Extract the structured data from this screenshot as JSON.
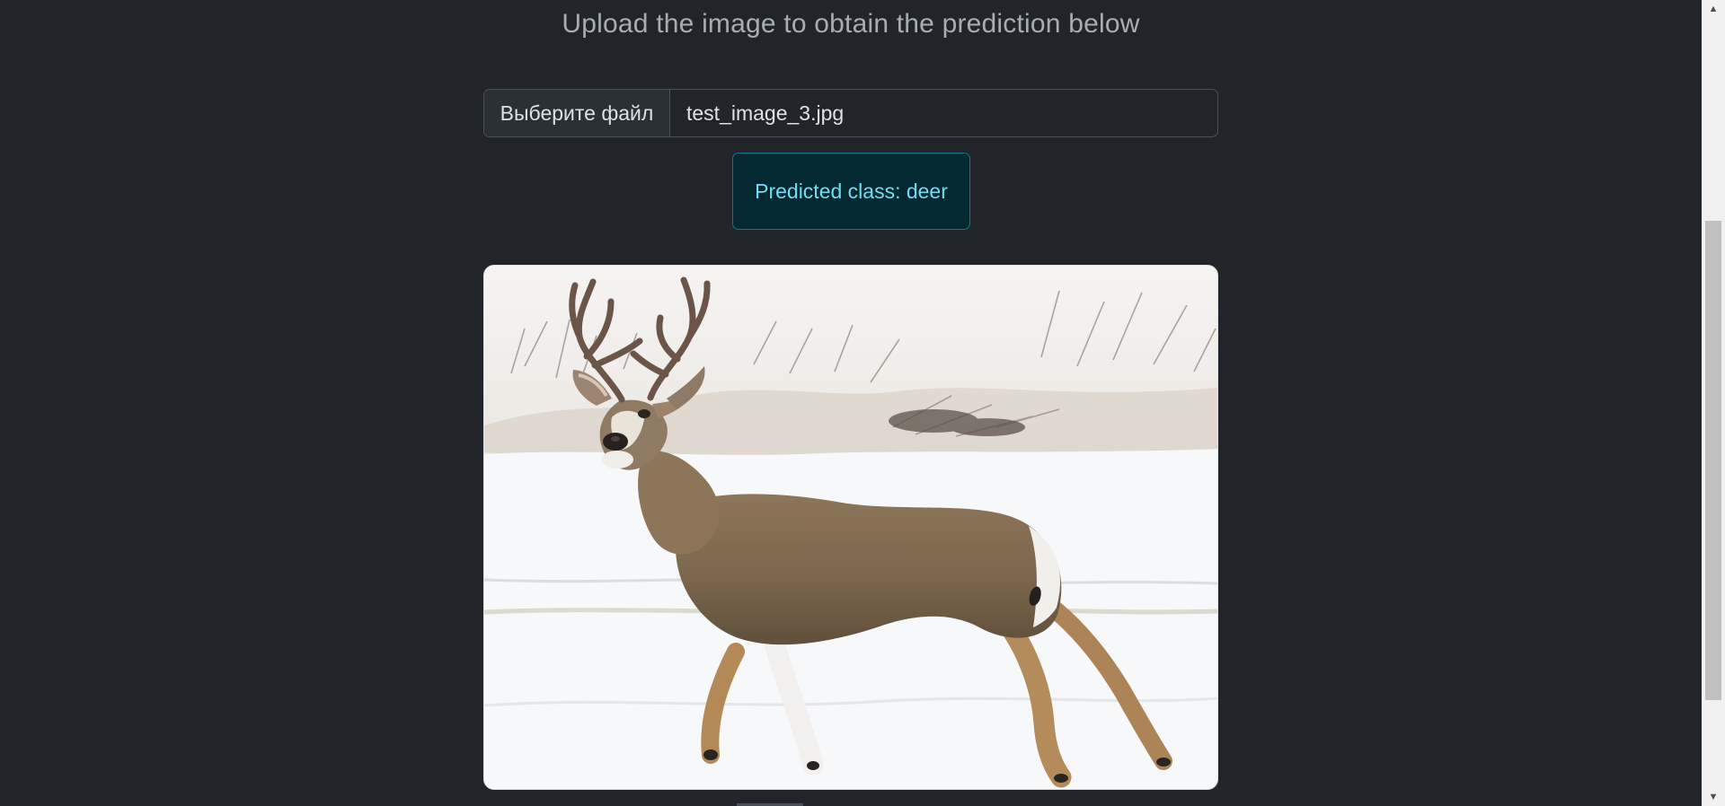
{
  "page": {
    "heading": "Upload the image to obtain the prediction below"
  },
  "upload": {
    "button_label": "Выберите файл",
    "file_name": "test_image_3.jpg"
  },
  "result": {
    "text": "Predicted class: deer"
  },
  "image": {
    "subject": "deer",
    "alt": "test_image_3.jpg"
  },
  "scrollbar": {
    "up_icon": "▲",
    "down_icon": "▼"
  },
  "colors": {
    "background": "#212529",
    "alert_background": "#032830",
    "alert_text": "#6edff6",
    "alert_border": "#087990"
  }
}
